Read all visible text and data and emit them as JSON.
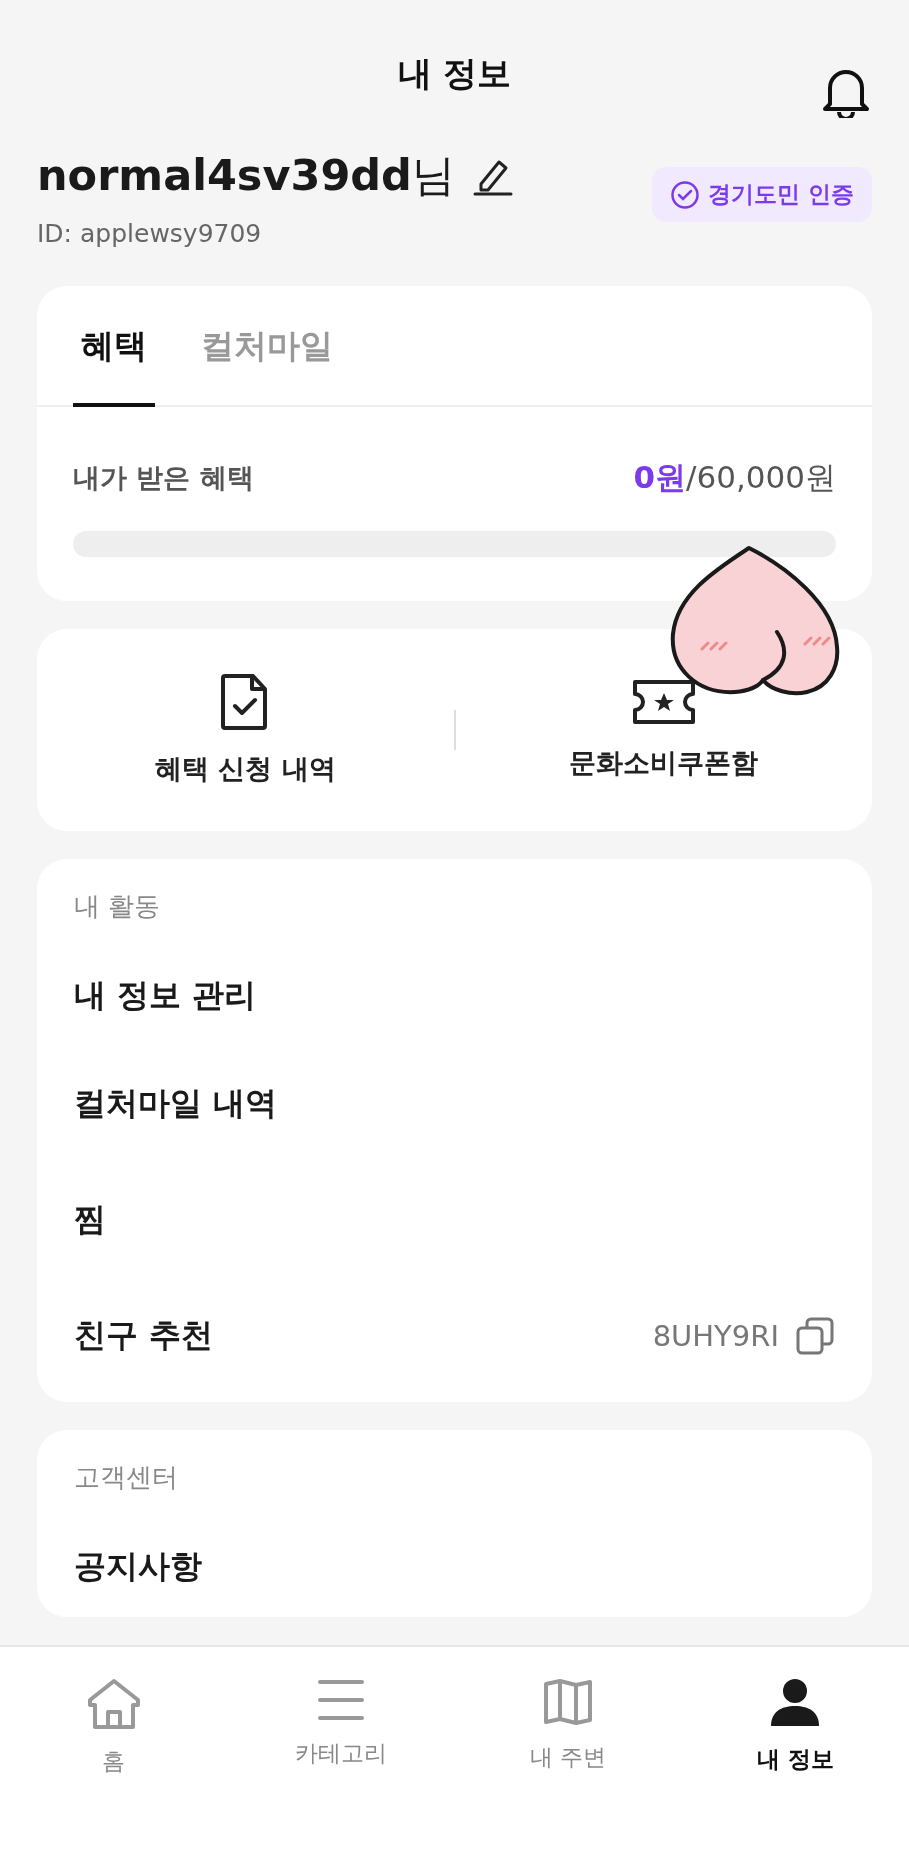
{
  "header": {
    "title": "내 정보"
  },
  "profile": {
    "name": "normal4sv39dd",
    "suffix": "님",
    "id": "ID: applewsy9709",
    "badge": "경기도민 인증"
  },
  "benefit_card": {
    "tabs": [
      {
        "label": "혜택",
        "selected": true
      },
      {
        "label": "컬처마일",
        "selected": false
      }
    ],
    "label": "내가 받은 혜택",
    "received": "0원",
    "total": "/60,000원",
    "level": 0
  },
  "shortcuts": [
    {
      "kind": "document",
      "label": "혜택 신청 내역"
    },
    {
      "kind": "ticket",
      "label": "문화소비쿠폰함"
    }
  ],
  "sections": [
    {
      "title": "내 활동",
      "items": [
        {
          "label": "내 정보 관리"
        },
        {
          "label": "컬처마일 내역"
        },
        {
          "label": "찜"
        },
        {
          "label": "친구 추천",
          "code": "8UHY9RI"
        }
      ]
    },
    {
      "title": "고객센터",
      "items": [
        {
          "label": "공지사항"
        }
      ]
    }
  ],
  "nav": [
    {
      "kind": "home",
      "label": "홈",
      "selected": false
    },
    {
      "kind": "menu",
      "label": "카테고리",
      "selected": false
    },
    {
      "kind": "map",
      "label": "내 주변",
      "selected": false
    },
    {
      "kind": "person",
      "label": "내 정보",
      "selected": true
    }
  ]
}
